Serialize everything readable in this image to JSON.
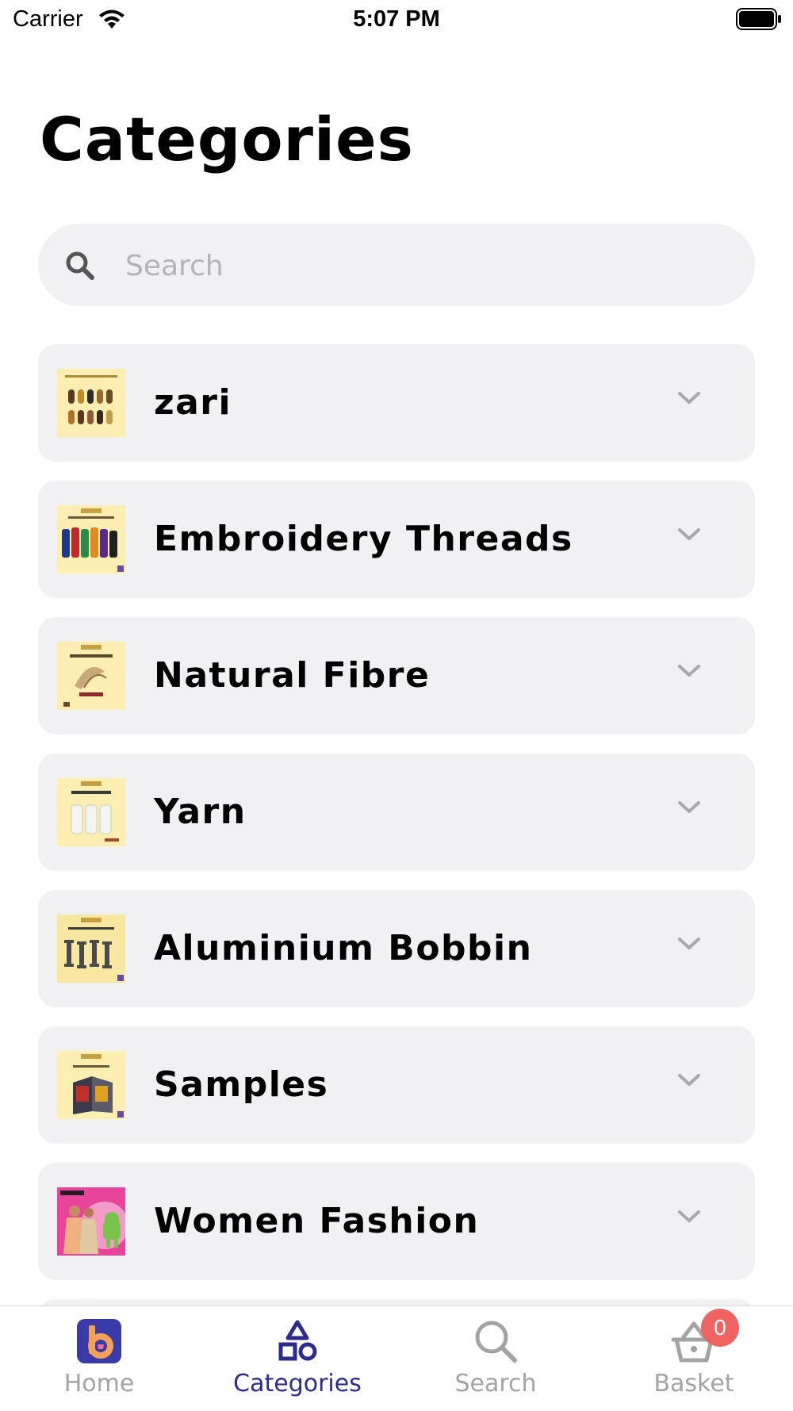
{
  "status_bar": {
    "carrier": "Carrier",
    "time": "5:07 PM"
  },
  "page": {
    "title": "Categories"
  },
  "search": {
    "placeholder": "Search",
    "icon": "search-icon"
  },
  "categories": [
    {
      "label": "zari",
      "thumb": "zari-thumbnail"
    },
    {
      "label": "Embroidery Threads",
      "thumb": "embroidery-threads-thumbnail"
    },
    {
      "label": "Natural Fibre",
      "thumb": "natural-fibre-thumbnail"
    },
    {
      "label": "Yarn",
      "thumb": "yarn-thumbnail"
    },
    {
      "label": "Aluminium Bobbin",
      "thumb": "aluminium-bobbin-thumbnail"
    },
    {
      "label": "Samples",
      "thumb": "samples-thumbnail"
    },
    {
      "label": "Women Fashion",
      "thumb": "women-fashion-thumbnail"
    }
  ],
  "tab_bar": {
    "tabs": [
      {
        "label": "Home",
        "icon": "home-logo-icon",
        "active": false
      },
      {
        "label": "Categories",
        "icon": "shapes-icon",
        "active": true
      },
      {
        "label": "Search",
        "icon": "search-icon",
        "active": false
      },
      {
        "label": "Basket",
        "icon": "basket-icon",
        "active": false
      }
    ],
    "basket_badge": "0"
  },
  "colors": {
    "accent": "#2e2b8e",
    "inactive": "#a3a3a3",
    "card_background": "#f1f1f3",
    "badge": "#f06363",
    "thumb_background": "#fbeeb0"
  }
}
